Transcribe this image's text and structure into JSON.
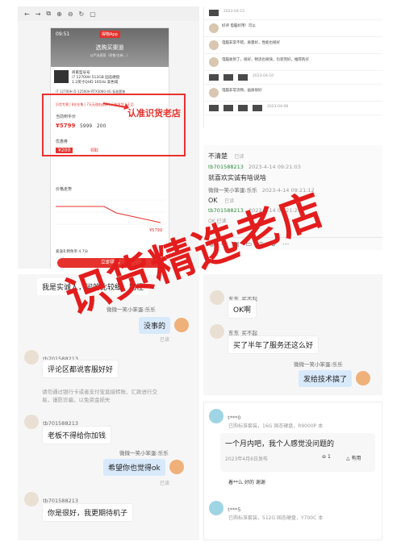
{
  "phone": {
    "time": "09:51",
    "app_badge": "得物App",
    "title": "选购买渠道",
    "subtitle": "以严选直营（寄售/全新...）",
    "product_line1": "商家型号号",
    "product_line2": "i7 12700H  512GB 固态硬盘",
    "product_line3": "1.2英寸QHD 165Hz 高色域",
    "product_line4": "i7 12700H i5-12500H RTX3060-4G  标准套装",
    "tags": "识货专营  |  8名在售  |  7天无理由退换  |  闪电发货  |  正品",
    "seller_label": "当前到手价",
    "price1": "¥5799",
    "price2": "5999",
    "price3": "200",
    "coupon_label": "优惠券",
    "coupon_price": "¥200",
    "coupon_btn": "领取",
    "trend_label": "价格走势",
    "trend_price": "¥5799",
    "bottom_link": "爱送礼物免单 4.7分",
    "buy_btn": "立即购买",
    "callout": "认准识货老店"
  },
  "desktop": {
    "rows": [
      {
        "text": "好评 电脑好用！可以",
        "date": "2023-04-15"
      },
      {
        "text": "电脑非常不错，质量好，性能也很好",
        "date": "2023-04-12"
      },
      {
        "text": "电脑收到了，很好，物流也很快，包装完好，推荐购买",
        "date": "2023-04-10"
      },
      {
        "text": "电脑非常流畅，画质很好",
        "date": "2023-04-08"
      }
    ]
  },
  "chat1": {
    "msg1": "不清楚",
    "msg1_status": "已读",
    "name1": "tb701588213",
    "ts1": "2023-4-14 09:21:03",
    "msg2": "就喜欢实诚有啥说啥",
    "name2": "微微一笑小笨蛋:乐乐",
    "ts2": "2023-4-14 09:21:12",
    "msg3": "OK",
    "msg3_status": "已读",
    "name3": "tb701588213",
    "ts3": "2023-4-14 09:21:29",
    "msg4": "OK 已读"
  },
  "chat2": {
    "msg1": "我是实诚人，问的比较细，别怪",
    "bubble_rt_name": "微微一笑小笨蛋:乐乐",
    "msg2": "没事的",
    "msg2_status": "已读",
    "name_l": "tb701588213",
    "msg3": "评论区都说客服好好",
    "sys": "请勿通过银行卡或者支付宝直接转账、汇款进行交易，谨防诈骗，以免资金损失",
    "name_l2": "tb701588213",
    "msg4": "老板不得给你加钱",
    "name_r2": "微微一笑小笨蛋:乐乐",
    "msg5": "希望你也觉得ok",
    "msg5_status": "已读",
    "name_l3": "tb701588213",
    "msg6": "你是很好，我更期待机子"
  },
  "chat3": {
    "name1": "东东_买不起",
    "msg1": "OK啊",
    "name2": "东东_买不起",
    "msg2": "买了半年了服务还这么好",
    "name3": "微微一笑小笨蛋:乐乐",
    "msg3": "发给技术搞了",
    "msg3_status": "已读"
  },
  "reviews": {
    "r1_user": "t***0",
    "r1_spec": "已购标准套装，16G 固态硬盘，R9000P 本",
    "r1_text": "一个月内吧，我个人感觉没问题的",
    "r1_date": "2023年4月6日发布",
    "r1_comments": "1",
    "r1_useful": "有用",
    "r1_reply_user": "着**么",
    "r1_reply": "好的 谢谢",
    "r2_user": "t***5",
    "r2_spec": "已购标准套装，512G 固态硬盘，Y700C 本"
  },
  "watermark": "识货精选老店",
  "colors": {
    "accent_red": "#e5322d",
    "bubble_blue": "#d8e9fb",
    "green_name": "#2d8a3e"
  }
}
